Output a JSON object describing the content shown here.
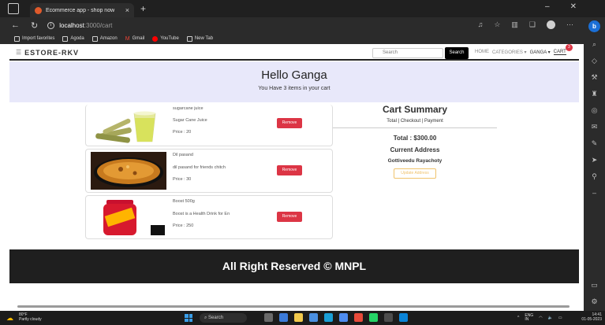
{
  "browser": {
    "tab_title": "Ecommerce app - shop now",
    "tab_close": "×",
    "new_tab": "+",
    "url_host": "localhost",
    "url_path": ":3000/cart",
    "favorites": [
      {
        "label": "Import favorites"
      },
      {
        "label": "Agoda"
      },
      {
        "label": "Amazon"
      },
      {
        "label": "Gmail"
      },
      {
        "label": "YouTube"
      },
      {
        "label": "New Tab"
      }
    ]
  },
  "navbar": {
    "brand": "ESTORE-RKV",
    "search_placeholder": "Search",
    "search_button": "Search",
    "home": "HOME",
    "categories": "CATEGORIES ▾",
    "user": "GANGA ▾",
    "cart": "CART",
    "cart_count": "3"
  },
  "hero": {
    "title": "Hello Ganga",
    "subtitle": "You Have 3 items in your cart"
  },
  "cart_items": [
    {
      "name": "sugarcane juice",
      "description": "Sugar Cane Juice",
      "price": "Price : 20",
      "remove": "Remove"
    },
    {
      "name": "Dil pasand",
      "description": "dil pasand for friends chitch",
      "price": "Price : 30",
      "remove": "Remove"
    },
    {
      "name": "Boost 500g",
      "description": "Boost is a Health Drink for En",
      "price": "Price : 250",
      "remove": "Remove"
    }
  ],
  "summary": {
    "title": "Cart Summary",
    "links": "Total | Checkout | Payment",
    "total": "Total : $300.00",
    "address_heading": "Current Address",
    "address": "Gottiveedu Rayachoty",
    "update_button": "Update Address"
  },
  "footer": {
    "text": "All Right Reserved © MNPL"
  },
  "taskbar": {
    "temp": "80°F",
    "weather": "Partly cloudy",
    "search": "Search",
    "lang": "ENG",
    "region": "IN",
    "time": "14:41",
    "date": "01-05-2023"
  }
}
